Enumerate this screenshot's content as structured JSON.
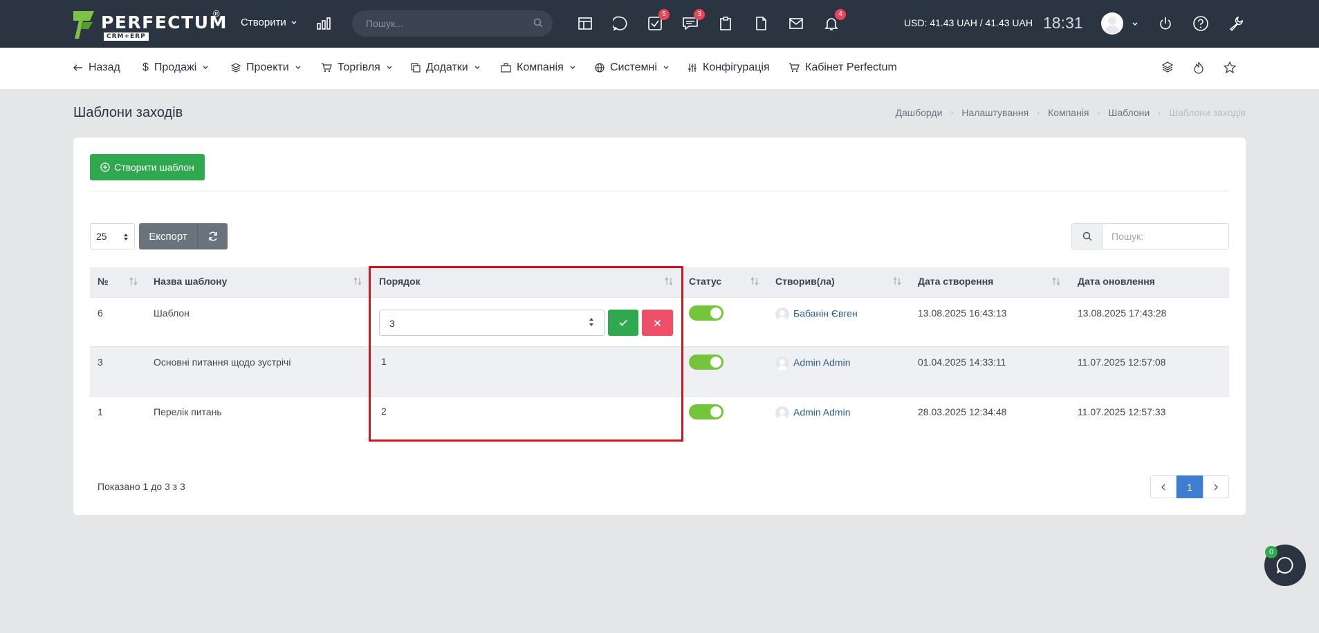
{
  "topbar": {
    "logo_text": "PERFECTUM",
    "logo_reg": "®",
    "logo_sub": "CRM+ERP",
    "create_label": "Створити",
    "search_placeholder": "Пошук...",
    "badges": {
      "tasks": "5",
      "messages": "3",
      "notifications": "4"
    },
    "currency": "USD: 41.43 UAH / 41.43 UAH",
    "time": "18:31"
  },
  "nav": {
    "back": "Назад",
    "sales": "Продажі",
    "projects": "Проекти",
    "trade": "Торгівля",
    "addons": "Додатки",
    "company": "Компанія",
    "system": "Системні",
    "config": "Конфігурація",
    "cabinet": "Кабінет Perfectum"
  },
  "page": {
    "title": "Шаблони заходів",
    "breadcrumb": [
      "Дашборди",
      "Налаштування",
      "Компанія",
      "Шаблони",
      "Шаблони заходів"
    ]
  },
  "toolbar": {
    "create_button": "Створити шаблон",
    "page_size": "25",
    "export_button": "Експорт",
    "search_placeholder": "Пошук:"
  },
  "table": {
    "headers": [
      "№",
      "Назва шаблону",
      "Порядок",
      "Статус",
      "Створив(ла)",
      "Дата створення",
      "Дата оновлення"
    ],
    "rows": [
      {
        "id": "6",
        "name": "Шаблон",
        "order": "3",
        "status": true,
        "author": "Бабанін Євген",
        "created": "13.08.2025 16:43:13",
        "updated": "13.08.2025 17:43:28"
      },
      {
        "id": "3",
        "name": "Основні питання щодо зустрічі",
        "order": "1",
        "status": true,
        "author": "Admin Admin",
        "created": "01.04.2025 14:33:11",
        "updated": "11.07.2025 12:57:08"
      },
      {
        "id": "1",
        "name": "Перелік питань",
        "order": "2",
        "status": true,
        "author": "Admin Admin",
        "created": "28.03.2025 12:34:48",
        "updated": "11.07.2025 12:57:33"
      }
    ],
    "info": "Показано 1 до 3 з 3"
  },
  "pagination": {
    "current": "1"
  },
  "chat": {
    "badge": "0"
  },
  "colors": {
    "topbar": "#2b3441",
    "success": "#2fa84f",
    "danger": "#ee4f68",
    "highlight": "#d8101a",
    "toggle": "#74c53a",
    "pager_active": "#3d7ed1"
  }
}
